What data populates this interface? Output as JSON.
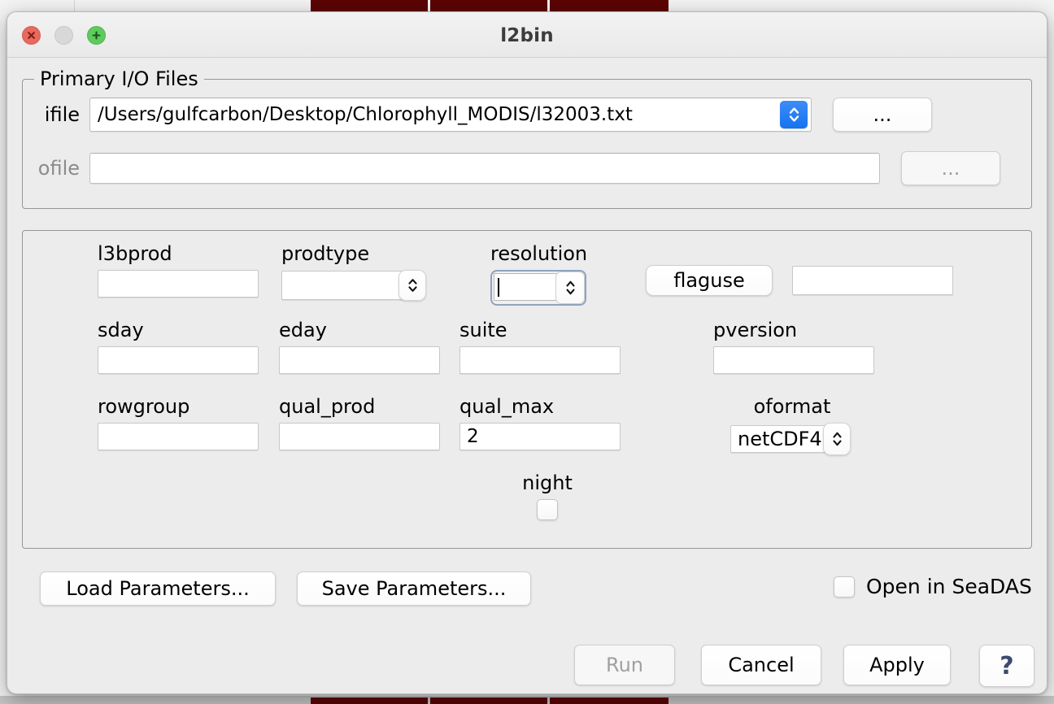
{
  "window": {
    "title": "l2bin",
    "traffic_lights": [
      {
        "name": "close",
        "glyph": "x",
        "color": "#e8695e",
        "enabled": true
      },
      {
        "name": "minimize",
        "glyph": "",
        "color": "#d8d8d8",
        "enabled": false
      },
      {
        "name": "zoom",
        "glyph": "+",
        "color": "#5fca5d",
        "enabled": true
      }
    ]
  },
  "io_group": {
    "legend": "Primary I/O Files",
    "ifile": {
      "label": "ifile",
      "value": "/Users/gulfcarbon/Desktop/Chlorophyll_MODIS/l32003.txt",
      "placeholder": "",
      "browse_label": "...",
      "stepper_icon": "up-down-chevron-icon",
      "stepper_color": "#1573f0",
      "enabled": true
    },
    "ofile": {
      "label": "ofile",
      "value": "",
      "placeholder": "",
      "browse_label": "...",
      "enabled": false
    }
  },
  "params": {
    "l3bprod": {
      "label": "l3bprod",
      "value": ""
    },
    "prodtype": {
      "label": "prodtype",
      "value": "",
      "type": "popup"
    },
    "resolution": {
      "label": "resolution",
      "value": "",
      "type": "spinner",
      "focused": true
    },
    "flaguse": {
      "button_label": "flaguse",
      "value": ""
    },
    "sday": {
      "label": "sday",
      "value": ""
    },
    "eday": {
      "label": "eday",
      "value": ""
    },
    "suite": {
      "label": "suite",
      "value": ""
    },
    "pversion": {
      "label": "pversion",
      "value": ""
    },
    "rowgroup": {
      "label": "rowgroup",
      "value": ""
    },
    "qual_prod": {
      "label": "qual_prod",
      "value": ""
    },
    "qual_max": {
      "label": "qual_max",
      "value": "2"
    },
    "oformat": {
      "label": "oformat",
      "value": "netCDF4",
      "type": "combo"
    },
    "night": {
      "label": "night",
      "checked": false
    }
  },
  "footer": {
    "load_parameters": "Load Parameters...",
    "save_parameters": "Save Parameters...",
    "open_in_seadas": {
      "label": "Open in SeaDAS",
      "checked": false
    },
    "run": {
      "label": "Run",
      "enabled": false
    },
    "cancel": {
      "label": "Cancel",
      "enabled": true
    },
    "apply": {
      "label": "Apply",
      "enabled": true
    },
    "help": {
      "label": "?",
      "enabled": true
    }
  },
  "colors": {
    "window_bg": "#ececec",
    "accent_blue": "#1573f0",
    "desktop_strip": "#5c0404",
    "disabled_text": "#8b8b8b"
  }
}
